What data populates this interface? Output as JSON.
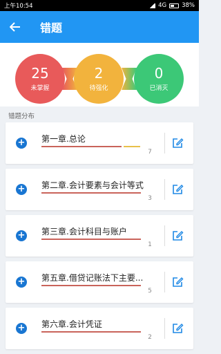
{
  "status_bar": {
    "time": "上午10:54",
    "network": "4G",
    "battery": "38%"
  },
  "app_bar": {
    "title": "错题"
  },
  "summary": {
    "unmastered": {
      "count": "25",
      "label": "未掌握"
    },
    "to_strengthen": {
      "count": "2",
      "label": "待强化"
    },
    "eliminated": {
      "count": "0",
      "label": "已消灭"
    }
  },
  "section_title": "错题分布",
  "chapters": [
    {
      "title": "第一章.总论",
      "count": "7"
    },
    {
      "title": "第二章.会计要素与会计等式",
      "count": "3"
    },
    {
      "title": "第三章.会计科目与账户",
      "count": "1"
    },
    {
      "title": "第五章.借贷记账法下主要...",
      "count": "5"
    },
    {
      "title": "第六章.会计凭证",
      "count": "2"
    }
  ],
  "colors": {
    "primary": "#2196f3",
    "red": "#e85a5a",
    "yellow": "#f2b33d",
    "green": "#3cc877"
  }
}
